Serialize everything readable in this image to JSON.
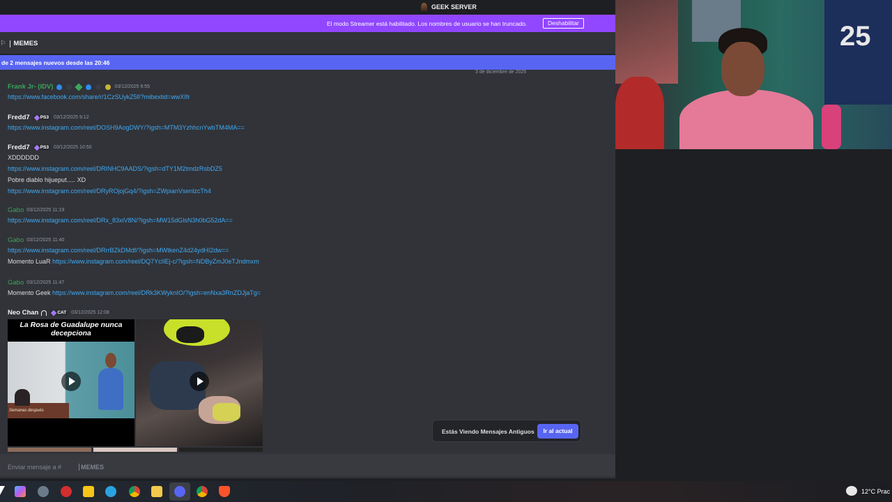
{
  "titlebar": {
    "server_name": "GEEK SERVER"
  },
  "streamer_banner": {
    "message": "El modo Streamer está habilitado. Los nombres de usuario se han truncado.",
    "disable_label": "Deshabilitar",
    "color": "#9147ff"
  },
  "channel": {
    "name": "MEMES"
  },
  "new_messages_bar": {
    "text": "de 2 mensajes nuevos desde las 20:46",
    "color": "#5865f2"
  },
  "date_divider": "3 de diciembre de 2025",
  "messages": [
    {
      "author": "Frank Jr- (IDV)",
      "timestamp": "03/12/2025 6:55",
      "lines": [
        {
          "link": "https://www.facebook.com/share/r/1CzSUykZ5f/?mibextid=wwXIfr"
        }
      ]
    },
    {
      "author": "Fredd7",
      "tag": "PS3",
      "timestamp": "03/12/2025 9:12",
      "lines": [
        {
          "link": "https://www.instagram.com/reel/DOSH9AogDWY/?igsh=MTM3YzhhcnYwbTM4MA=="
        }
      ]
    },
    {
      "author": "Fredd7",
      "tag": "PS3",
      "timestamp": "03/12/2025 10:50",
      "lines": [
        {
          "text": "XDDDDDD"
        },
        {
          "link": "https://www.instagram.com/reel/DRINHC9AADS/?igsh=dTY1M2tmdzRsbDZ5"
        },
        {
          "text": "Pobre diablo hijueput..... XD"
        },
        {
          "link": "https://www.instagram.com/reel/DRyROjojGq4/?igsh=ZWpianVsenlzcTh4"
        }
      ]
    },
    {
      "author": "Gabo",
      "timestamp": "03/12/2025 11:19",
      "lines": [
        {
          "link": "https://www.instagram.com/reel/DRx_83xiV8N/?igsh=MW15dGlsN3h0bG52dA=="
        }
      ]
    },
    {
      "author": "Gabo",
      "timestamp": "03/12/2025 11:40",
      "lines": [
        {
          "link": "https://www.instagram.com/reel/DRrrBZkDMdf/?igsh=MWtkenZ4d24ydHI2dw=="
        },
        {
          "text": "Momento LuaR",
          "link": "https://www.instagram.com/reel/DQ7YcIIEj-c/?igsh=NDByZmJ0eTJndmxm"
        }
      ]
    },
    {
      "author": "Gabo",
      "timestamp": "03/12/2025 11:47",
      "lines": [
        {
          "text": "Momento Geek",
          "link": "https://www.instagram.com/reel/DRk3KWyknIO/?igsh=enNxa3RnZDJjaTg="
        }
      ]
    },
    {
      "author": "Neo Chan",
      "tag": "CAT",
      "timestamp": "03/12/2025 12:08",
      "video1_caption": "La Rosa de Guadalupe nunca decepciona",
      "video1_footer": "Semanas después"
    }
  ],
  "toast": {
    "text": "Estás Viendo Mensajes Antiguos",
    "button": "Ir al actual"
  },
  "composer": {
    "placeholder": "Enviar mensaje a #",
    "channel": "MEMES"
  },
  "webcam": {
    "jersey_number": "25"
  },
  "taskbar": {
    "temperature": "12°C",
    "weather_text": "Prac"
  }
}
